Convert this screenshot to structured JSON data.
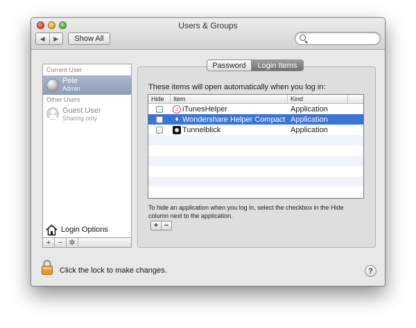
{
  "window": {
    "title": "Users & Groups"
  },
  "toolbar": {
    "back_glyph": "◀",
    "forward_glyph": "▶",
    "show_all_label": "Show All",
    "search_value": ""
  },
  "sidebar": {
    "current_user_heading": "Current User",
    "current_user": {
      "name": "Pele",
      "role": "Admin"
    },
    "other_users_heading": "Other Users",
    "other_users": [
      {
        "name": "Guest User",
        "status": "Sharing only"
      }
    ],
    "login_options_label": "Login Options",
    "bottom_buttons": [
      "+",
      "−",
      "✲"
    ]
  },
  "tabs": [
    {
      "label": "Password",
      "selected": false
    },
    {
      "label": "Login Items",
      "selected": true
    }
  ],
  "login_items": {
    "intro": "These items will open automatically when you log in:",
    "columns": {
      "hide": "Hide",
      "item": "Item",
      "kind": "Kind"
    },
    "rows": [
      {
        "name": "iTunesHelper",
        "kind": "Application",
        "hidden": false,
        "selected": false,
        "icon": "itunes-icon"
      },
      {
        "name": "Wondershare Helper Compact",
        "kind": "Application",
        "hidden": false,
        "selected": true,
        "icon": "wondershare-icon"
      },
      {
        "name": "Tunnelblick",
        "kind": "Application",
        "hidden": false,
        "selected": false,
        "icon": "tunnelblick-icon"
      }
    ],
    "hint": "To hide an application when you log in, select the checkbox in the Hide column next to the application.",
    "add_label": "+",
    "remove_label": "−"
  },
  "footer": {
    "lock_text": "Click the lock to make changes.",
    "help_label": "?"
  },
  "colors": {
    "selection": "#3875d7",
    "sidebar_selection": "#9aa8bf",
    "alt_row": "#f1f5fa"
  }
}
